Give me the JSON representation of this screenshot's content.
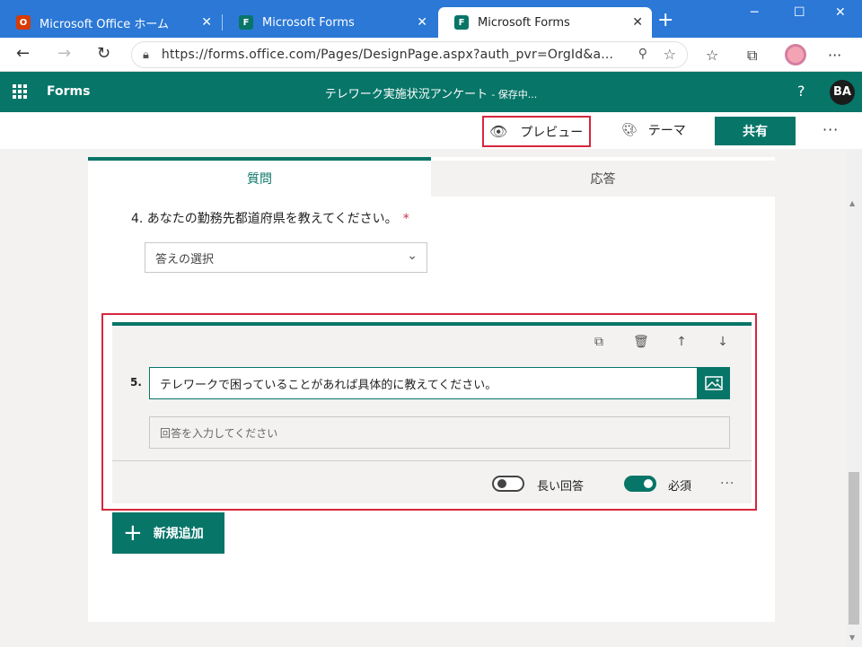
{
  "browser": {
    "tabs": [
      {
        "label": "Microsoft Office ホーム",
        "icon": "office-icon",
        "color": "#d83b01"
      },
      {
        "label": "Microsoft Forms",
        "icon": "forms-icon",
        "color": "#077568"
      },
      {
        "label": "Microsoft Forms",
        "icon": "forms-icon",
        "color": "#077568",
        "active": true
      }
    ],
    "url": "https://forms.office.com/Pages/DesignPage.aspx?auth_pvr=OrgId&a..."
  },
  "app": {
    "name": "Forms",
    "form_title": "テレワーク実施状況アンケート",
    "save_status": "- 保存中...",
    "help": "?",
    "avatar_initials": "BA"
  },
  "commands": {
    "preview": "プレビュー",
    "theme": "テーマ",
    "share": "共有",
    "more": "···"
  },
  "tabs": {
    "questions": "質問",
    "responses": "応答"
  },
  "question4": {
    "title": "4. あなたの勤務先都道府県を教えてください。",
    "required_mark": "*",
    "select_placeholder": "答えの選択"
  },
  "question5": {
    "number": "5.",
    "text": "テレワークで困っていることがあれば具体的に教えてください。",
    "answer_placeholder": "回答を入力してください",
    "long_answer_label": "長い回答",
    "long_answer_on": false,
    "required_label": "必須",
    "required_on": true,
    "more": "···"
  },
  "add_new": "新規追加",
  "colors": {
    "accent": "#077568",
    "highlight": "#d7263d",
    "browser": "#2b78d6"
  }
}
